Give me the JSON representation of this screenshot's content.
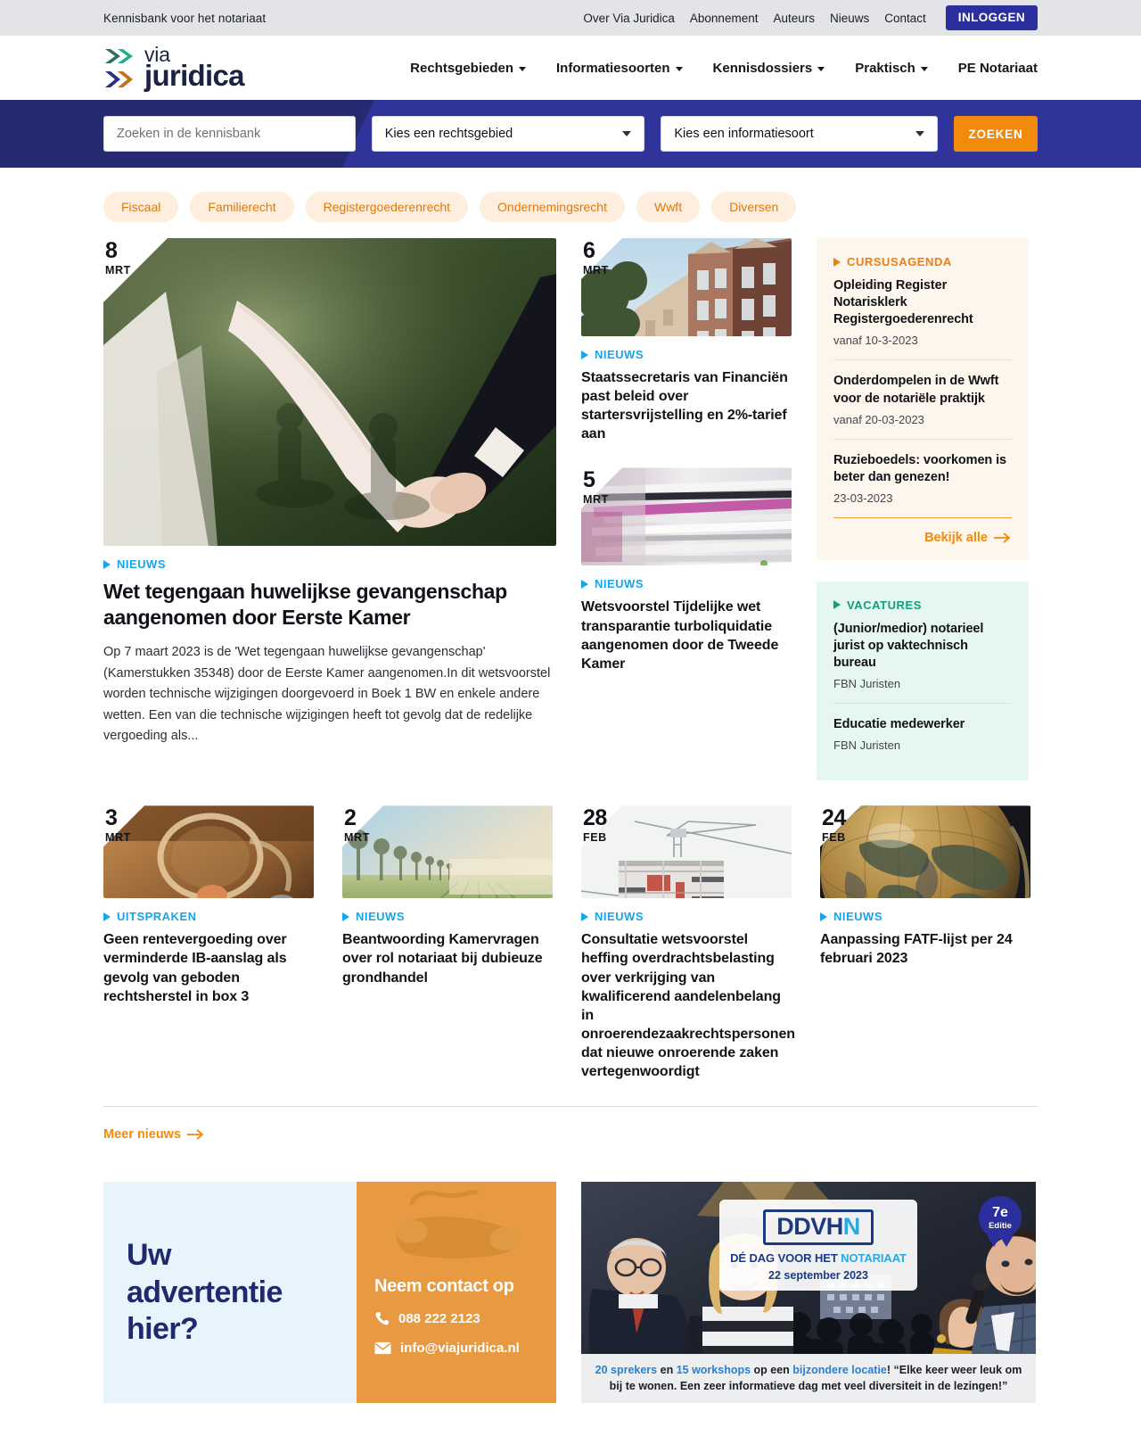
{
  "utility": {
    "tagline": "Kennisbank voor het notariaat",
    "links": [
      {
        "label": "Over Via Juridica"
      },
      {
        "label": "Abonnement"
      },
      {
        "label": "Auteurs"
      },
      {
        "label": "Nieuws"
      },
      {
        "label": "Contact"
      }
    ],
    "login_label": "INLOGGEN",
    "login_color": "#2b2f9e"
  },
  "brand": {
    "line1": "via",
    "line2": "juridica",
    "chevron_top_colors": [
      "#2f6f5e",
      "#1fae8f"
    ],
    "chevron_bottom_colors": [
      "#2b2f80",
      "#c2701a"
    ]
  },
  "nav": {
    "items": [
      {
        "label": "Rechtsgebieden",
        "has_caret": true
      },
      {
        "label": "Informatiesoorten",
        "has_caret": true
      },
      {
        "label": "Kennisdossiers",
        "has_caret": true
      },
      {
        "label": "Praktisch",
        "has_caret": true
      },
      {
        "label": "PE Notariaat",
        "has_caret": false
      }
    ]
  },
  "search": {
    "input_placeholder": "Zoeken in de kennisbank",
    "input_value": "",
    "rechtsgebied_value": "Kies een rechtsgebied",
    "informatiesoort_value": "Kies een informatiesoort",
    "button_label": "ZOEKEN",
    "button_color": "#f28a0c",
    "band_color": "#2b2f80"
  },
  "tags": [
    {
      "label": "Fiscaal"
    },
    {
      "label": "Familierecht"
    },
    {
      "label": "Registergoederenrecht"
    },
    {
      "label": "Ondernemingsrecht"
    },
    {
      "label": "Wwft"
    },
    {
      "label": "Diversen"
    }
  ],
  "hero": {
    "day": "8",
    "month": "MRT",
    "category": "NIEUWS",
    "title": "Wet tegengaan huwelijkse gevangenschap aangenomen door Eerste Kamer",
    "excerpt": "Op 7 maart 2023 is de 'Wet tegengaan huwelijkse gevangenschap' (Kamerstukken 35348) door de Eerste Kamer aangenomen.In dit wetsvoorstel worden technische wijzigingen doorgevoerd in Boek 1 BW en enkele andere wetten. Een van die technische wijzigingen heeft tot gevolg dat de redelijke vergoeding als...",
    "image_alt": "bride and groom holding hands"
  },
  "mid_articles": [
    {
      "day": "6",
      "month": "MRT",
      "category": "NIEUWS",
      "title": "Staatssecretaris van Financiën past beleid over startersvrijstelling en 2%-tarief aan",
      "image_alt": "amsterdam canal houses facade"
    },
    {
      "day": "5",
      "month": "MRT",
      "category": "NIEUWS",
      "title": "Wetsvoorstel Tijdelijke wet transparantie turboliquidatie aangenomen door de Tweede Kamer",
      "image_alt": "stack of paper documents"
    }
  ],
  "sidebar": {
    "cursusagenda": {
      "heading": "CURSUSAGENDA",
      "accent": "#ee7f10",
      "items": [
        {
          "title": "Opleiding Register Notarisklerk Registergoederenrecht",
          "meta": "vanaf 10-3-2023"
        },
        {
          "title": "Onderdompelen in de Wwft voor de notariële praktijk",
          "meta": "vanaf 20-03-2023"
        },
        {
          "title": "Ruzieboedels: voorkomen is beter dan genezen!",
          "meta": "23-03-2023"
        }
      ],
      "link_label": "Bekijk alle"
    },
    "vacatures": {
      "heading": "VACATURES",
      "accent": "#11a07a",
      "items": [
        {
          "title": "(Junior/medior) notarieel jurist op vaktechnisch bureau",
          "meta": "FBN Juristen"
        },
        {
          "title": "Educatie medewerker",
          "meta": "FBN Juristen"
        }
      ]
    }
  },
  "bottom_articles": [
    {
      "day": "3",
      "month": "MRT",
      "category": "UITSPRAKEN",
      "title": "Geen rentevergoeding over verminderde IB-aanslag als gevolg van geboden rechtsherstel in box 3",
      "image_alt": "jar spilling coins"
    },
    {
      "day": "2",
      "month": "MRT",
      "category": "NIEUWS",
      "title": "Beantwoording Kamervragen over rol notariaat bij dubieuze grondhandel",
      "image_alt": "misty field with trees"
    },
    {
      "day": "28",
      "month": "FEB",
      "category": "NIEUWS",
      "title": "Consultatie wetsvoorstel heffing overdrachtsbelasting over verkrijging van kwalificerend aandelenbelang in onroerendezaakrechtspersonen dat nieuwe onroerende zaken vertegenwoordigt",
      "image_alt": "building under construction with crane"
    },
    {
      "day": "24",
      "month": "FEB",
      "category": "NIEUWS",
      "title": "Aanpassing FATF-lijst per 24 februari 2023",
      "image_alt": "antique globe showing asia"
    }
  ],
  "more_news": {
    "label": "Meer nieuws"
  },
  "ads": {
    "placeholder": {
      "headline": "Uw advertentie hier?",
      "contact_heading": "Neem contact op",
      "phone": "088 222 2123",
      "email": "info@viajuridica.nl",
      "blue_bg": "#e8f4fb",
      "orange_bg": "#e79a42"
    },
    "ddvhn": {
      "logo": "DDVHN",
      "logo_highlight": "N",
      "subtitle_main": "DÉ DAG VOOR HET ",
      "subtitle_highlight": "NOTARIAAT",
      "date": "22 september 2023",
      "ribbon_number": "7e",
      "ribbon_label": "Editie",
      "caption_parts": [
        {
          "text": "20 sprekers",
          "highlight": true
        },
        {
          "text": " en ",
          "highlight": false
        },
        {
          "text": "15 workshops",
          "highlight": true
        },
        {
          "text": " op een ",
          "highlight": false
        },
        {
          "text": "bijzondere locatie",
          "highlight": true
        },
        {
          "text": "! “Elke keer weer leuk om bij te wonen. Een zeer informatieve dag met veel diversiteit in de lezingen!”",
          "highlight": false
        }
      ]
    }
  }
}
